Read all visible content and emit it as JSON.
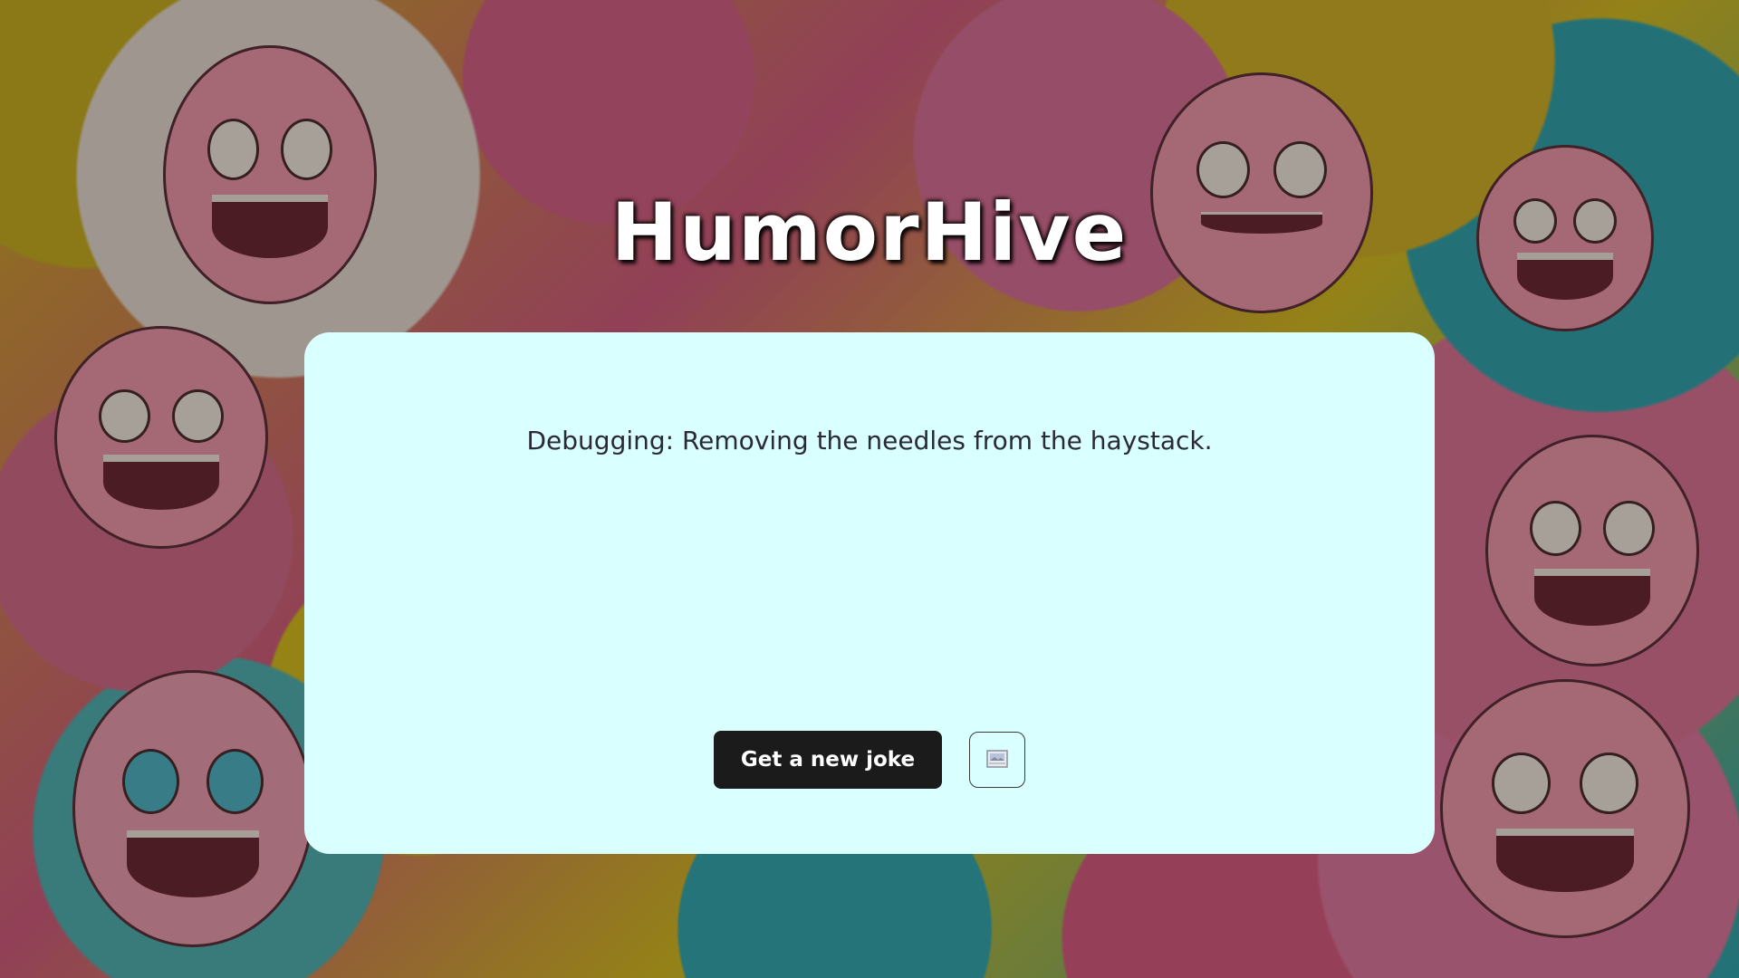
{
  "app": {
    "title": "HumorHive"
  },
  "joke": {
    "text": "Debugging: Removing the needles from the haystack."
  },
  "actions": {
    "new_joke_label": "Get a new joke",
    "image_button_icon": "broken-image-icon"
  },
  "colors": {
    "card_background": "#d9ffff",
    "button_background": "#1b1b1b",
    "title_color": "#ffffff"
  }
}
